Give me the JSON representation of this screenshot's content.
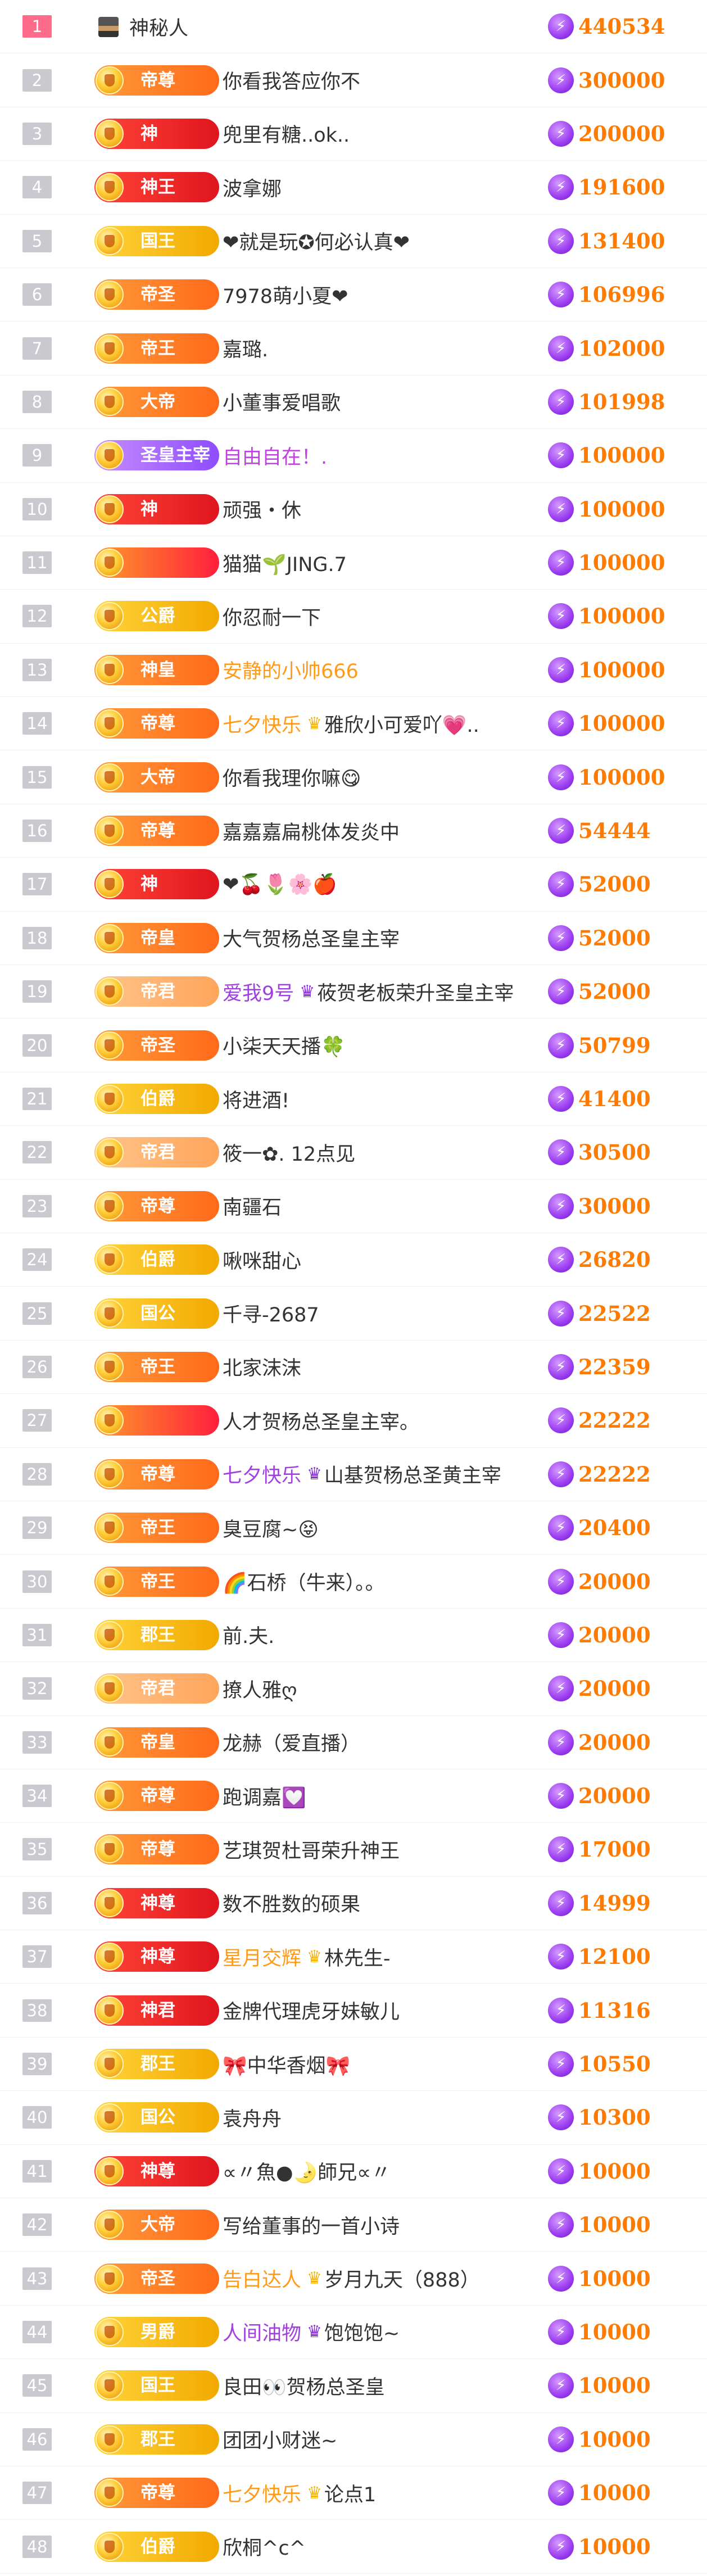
{
  "currency_icon": "lightning-coin-icon",
  "colors": {
    "rank_top": "#ff6b8a",
    "rank_default": "#c9c9cf",
    "amount": "#ff7a00",
    "name_default": "#333333",
    "name_purple": "#a040e0",
    "name_orange": "#ff9a1a"
  },
  "rows": [
    {
      "rank": "1",
      "badge": "",
      "name": "神秘人",
      "amount": "440534"
    },
    {
      "rank": "2",
      "badge": "帝尊",
      "name": "你看我答应你不",
      "amount": "300000"
    },
    {
      "rank": "3",
      "badge": "神",
      "name": "兜里有糖..ok..",
      "amount": "200000"
    },
    {
      "rank": "4",
      "badge": "神王",
      "name": "波拿娜",
      "amount": "191600"
    },
    {
      "rank": "5",
      "badge": "国王",
      "name": "❤就是玩✪何必认真❤",
      "amount": "131400"
    },
    {
      "rank": "6",
      "badge": "帝圣",
      "name": "7978萌小夏❤",
      "amount": "106996"
    },
    {
      "rank": "7",
      "badge": "帝王",
      "name": "嘉璐.",
      "amount": "102000"
    },
    {
      "rank": "8",
      "badge": "大帝",
      "name": "小董事爱唱歌",
      "amount": "101998"
    },
    {
      "rank": "9",
      "badge": "圣皇主宰",
      "name": "自由自在！.",
      "amount": "100000"
    },
    {
      "rank": "10",
      "badge": "神",
      "name": "顽强・休",
      "amount": "100000"
    },
    {
      "rank": "11",
      "badge": "",
      "name": "猫猫🌱JING.7",
      "amount": "100000"
    },
    {
      "rank": "12",
      "badge": "公爵",
      "name": "你忍耐一下",
      "amount": "100000"
    },
    {
      "rank": "13",
      "badge": "神皇",
      "name": "安静的小帅666",
      "amount": "100000"
    },
    {
      "rank": "14",
      "badge": "帝尊",
      "tag": "七夕快乐",
      "crown": "gold",
      "name": "雅欣小可爱吖💗..",
      "amount": "100000"
    },
    {
      "rank": "15",
      "badge": "大帝",
      "name": "你看我理你嘛😋",
      "amount": "100000"
    },
    {
      "rank": "16",
      "badge": "帝尊",
      "name": "嘉嘉嘉扁桃体发炎中",
      "amount": "54444"
    },
    {
      "rank": "17",
      "badge": "神",
      "name": "❤🍒🌷🌸🍎",
      "amount": "52000"
    },
    {
      "rank": "18",
      "badge": "帝皇",
      "name": "大气贺杨总圣皇主宰",
      "amount": "52000"
    },
    {
      "rank": "19",
      "badge": "帝君",
      "tag": "爱我9号",
      "crown": "purple",
      "name": "莜贺老板荣升圣皇主宰",
      "amount": "52000"
    },
    {
      "rank": "20",
      "badge": "帝圣",
      "name": "小柒天天播🍀",
      "amount": "50799"
    },
    {
      "rank": "21",
      "badge": "伯爵",
      "name": "将进酒!",
      "amount": "41400"
    },
    {
      "rank": "22",
      "badge": "帝君",
      "name": "筱一✿. 12点见",
      "amount": "30500"
    },
    {
      "rank": "23",
      "badge": "帝尊",
      "name": "南疆石",
      "amount": "30000"
    },
    {
      "rank": "24",
      "badge": "伯爵",
      "name": "啾咪甜心",
      "amount": "26820"
    },
    {
      "rank": "25",
      "badge": "国公",
      "name": "千寻-2687",
      "amount": "22522"
    },
    {
      "rank": "26",
      "badge": "帝王",
      "name": "北家沫沫",
      "amount": "22359"
    },
    {
      "rank": "27",
      "badge": "",
      "name": "人才贺杨总圣皇主宰。",
      "amount": "22222"
    },
    {
      "rank": "28",
      "badge": "帝尊",
      "tag": "七夕快乐",
      "crown": "purple",
      "name": "山基贺杨总圣黄主宰",
      "amount": "22222"
    },
    {
      "rank": "29",
      "badge": "帝王",
      "name": "臭豆腐~😝",
      "amount": "20400"
    },
    {
      "rank": "30",
      "badge": "帝王",
      "name": "🌈石桥（牛来）。。",
      "amount": "20000"
    },
    {
      "rank": "31",
      "badge": "郡王",
      "name": "前.夫.",
      "amount": "20000"
    },
    {
      "rank": "32",
      "badge": "帝君",
      "name": "撩人雅ღ",
      "amount": "20000"
    },
    {
      "rank": "33",
      "badge": "帝皇",
      "name": "龙赫（爱直播）",
      "amount": "20000"
    },
    {
      "rank": "34",
      "badge": "帝尊",
      "name": "跑调嘉💟",
      "amount": "20000"
    },
    {
      "rank": "35",
      "badge": "帝尊",
      "name": "艺琪贺杜哥荣升神王",
      "amount": "17000"
    },
    {
      "rank": "36",
      "badge": "神尊",
      "name": "数不胜数的硕果",
      "amount": "14999"
    },
    {
      "rank": "37",
      "badge": "神尊",
      "tag": "星月交辉",
      "crown": "gold",
      "name": "林先生-",
      "amount": "12100"
    },
    {
      "rank": "38",
      "badge": "神君",
      "name": "金牌代理虎牙妹敏儿",
      "amount": "11316"
    },
    {
      "rank": "39",
      "badge": "郡王",
      "name": "🎀中华香烟🎀",
      "amount": "10550"
    },
    {
      "rank": "40",
      "badge": "国公",
      "name": "袁舟舟",
      "amount": "10300"
    },
    {
      "rank": "41",
      "badge": "神尊",
      "name": "∝〃魚●🌛師兄∝〃",
      "amount": "10000"
    },
    {
      "rank": "42",
      "badge": "大帝",
      "name": "写给董事的一首小诗",
      "amount": "10000"
    },
    {
      "rank": "43",
      "badge": "帝圣",
      "tag": "告白达人",
      "crown": "gold",
      "name": "岁月九天（888）",
      "amount": "10000"
    },
    {
      "rank": "44",
      "badge": "男爵",
      "tag": "人间油物",
      "crown": "purple",
      "name": "饱饱饱~",
      "amount": "10000"
    },
    {
      "rank": "45",
      "badge": "国王",
      "name": "良田👀贺杨总圣皇",
      "amount": "10000"
    },
    {
      "rank": "46",
      "badge": "郡王",
      "name": "团团小财迷~",
      "amount": "10000"
    },
    {
      "rank": "47",
      "badge": "帝尊",
      "tag": "七夕快乐",
      "crown": "gold",
      "name": "论点1",
      "amount": "10000"
    },
    {
      "rank": "48",
      "badge": "伯爵",
      "name": "欣桐^c^",
      "amount": "10000"
    }
  ]
}
